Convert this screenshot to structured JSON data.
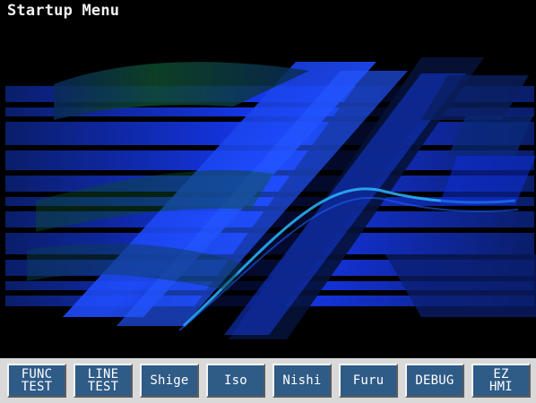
{
  "window": {
    "title": "Startup Menu"
  },
  "buttons": [
    {
      "label": "FUNC\nTEST"
    },
    {
      "label": "LINE\nTEST"
    },
    {
      "label": "Shige"
    },
    {
      "label": "Iso"
    },
    {
      "label": "Nishi"
    },
    {
      "label": "Furu"
    },
    {
      "label": "DEBUG"
    },
    {
      "label": "EZ\nHMI"
    }
  ],
  "colors": {
    "button_bg": "#2f5b87",
    "button_text": "#ffffff",
    "title_text": "#f2f2f2",
    "artwork_accent": "#1e40ff"
  },
  "artwork": {
    "description_icon": "blue-diagonal-abstract-graphic"
  }
}
